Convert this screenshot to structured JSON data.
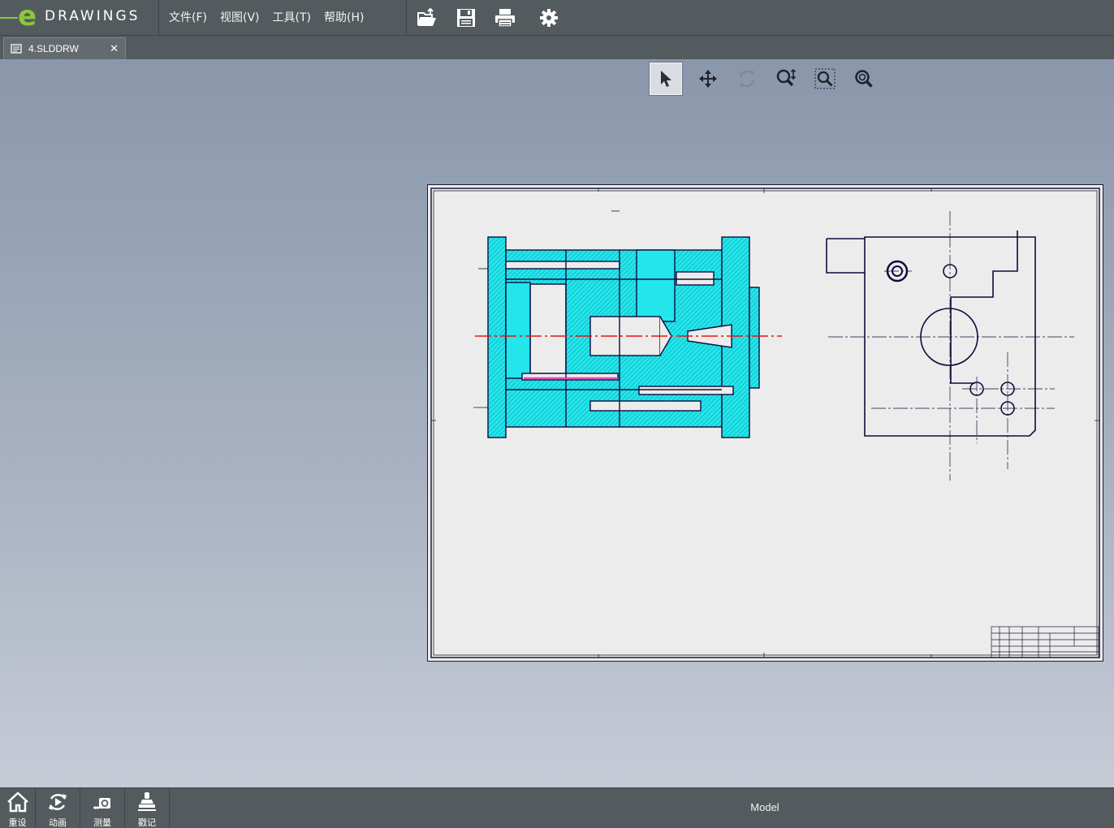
{
  "app": {
    "logo_e": "e",
    "logo_text": "DRAWINGS",
    "brand_color": "#8cc63f"
  },
  "menu": {
    "file": "文件(F)",
    "view": "视图(V)",
    "tools": "工具(T)",
    "help": "帮助(H)"
  },
  "toolbar_icons": [
    "open-icon",
    "save-icon",
    "print-icon",
    "settings-gear-icon"
  ],
  "tab": {
    "label": "4.SLDDRW",
    "close": "✕"
  },
  "view_tools": [
    "select-arrow-icon",
    "pan-move-icon",
    "rotate-icon",
    "zoom-icon",
    "zoom-to-area-icon",
    "zoom-to-fit-icon"
  ],
  "colors": {
    "section_fill": "#22e6ec",
    "outline": "#0d0d3d",
    "centerline_red": "#e81414",
    "sheet_bg": "#ececec"
  },
  "bottom": {
    "home": "重设",
    "animate": "动画",
    "measure": "测量",
    "stamp": "戳记",
    "mode": "Model"
  }
}
